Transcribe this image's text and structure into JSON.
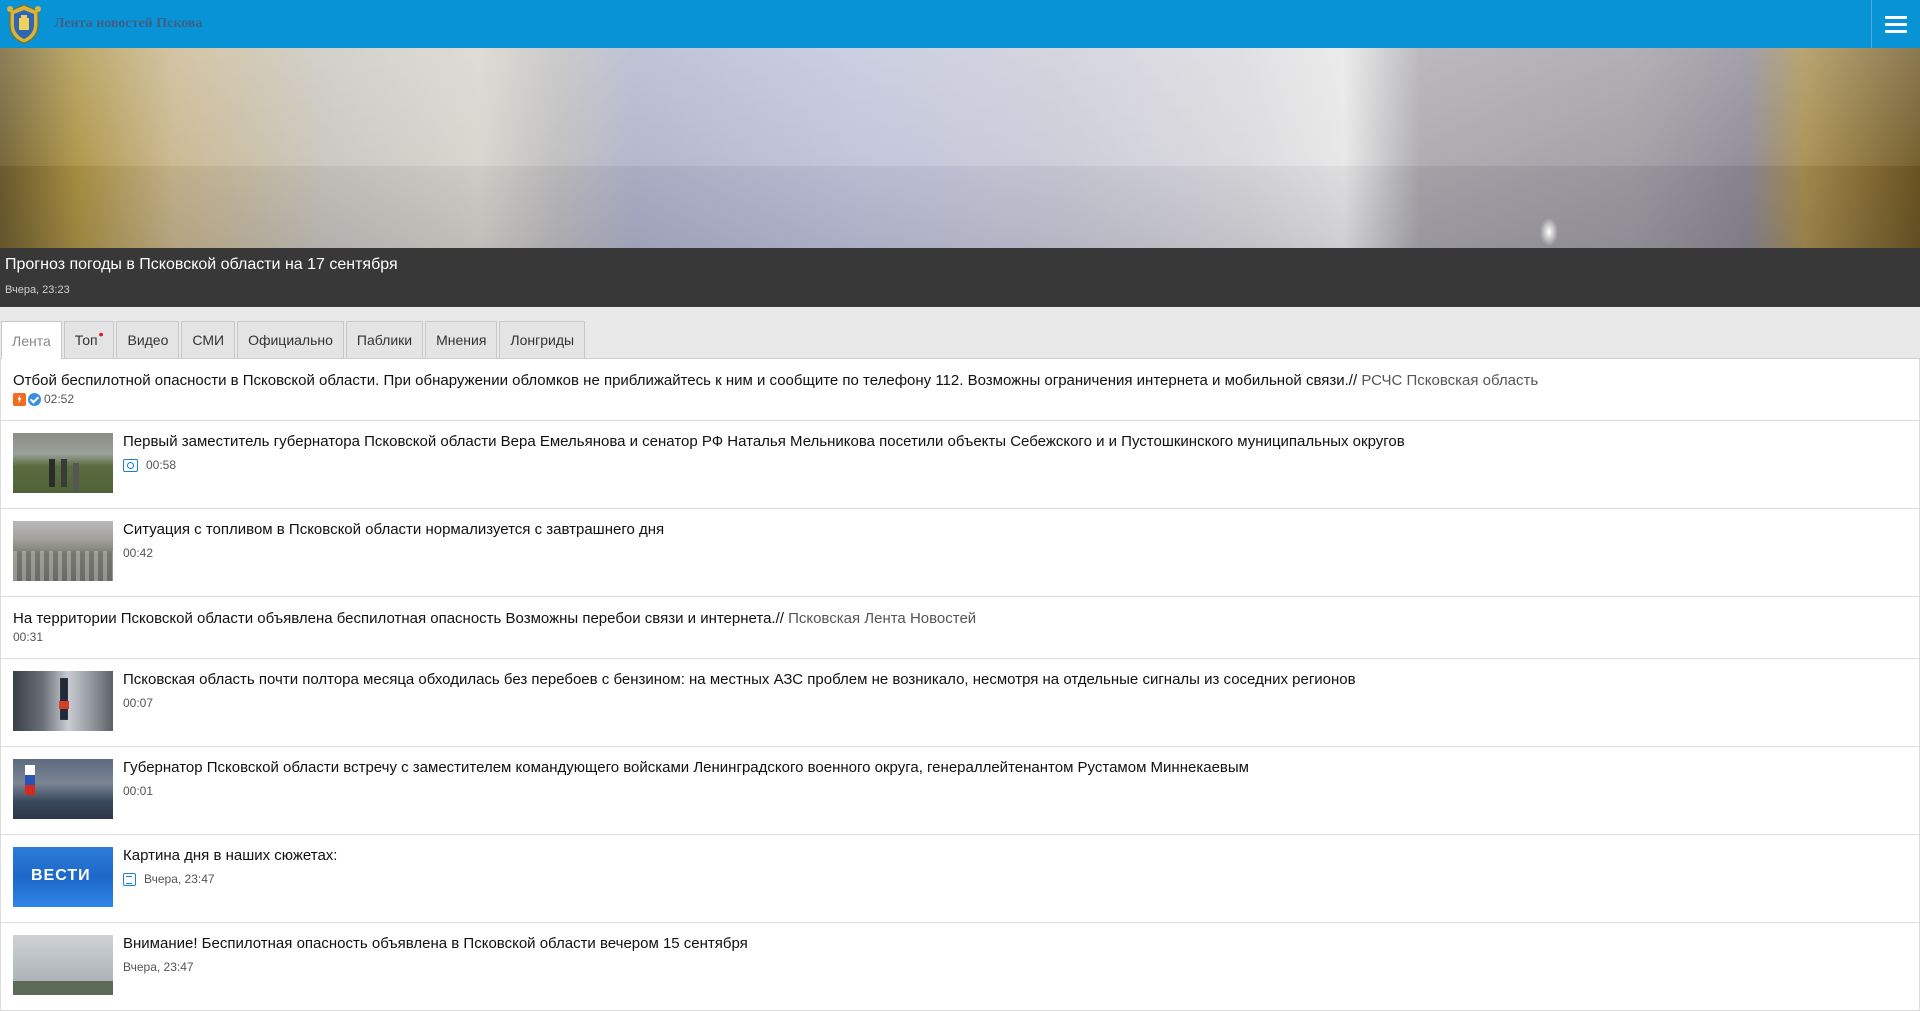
{
  "header": {
    "site_title": "Лента новостей Пскова",
    "logo_icon": "coat-of-arms-icon",
    "menu_icon": "hamburger-menu-icon",
    "brand_color": "#0893d6"
  },
  "hero": {
    "title": "Прогноз погоды в Псковской области на 17 сентября",
    "time": "Вчера, 23:23"
  },
  "tabs": [
    {
      "label": "Лента",
      "active": true
    },
    {
      "label": "Топ",
      "marker": "•"
    },
    {
      "label": "Видео"
    },
    {
      "label": "СМИ"
    },
    {
      "label": "Официально"
    },
    {
      "label": "Паблики"
    },
    {
      "label": "Мнения"
    },
    {
      "label": "Лонгриды"
    }
  ],
  "feed": [
    {
      "title": "Отбой беспилотной опасности в Псковской области. При обнаружении обломков не приближайтесь к ним и сообщите по телефону 112. Возможны ограничения интернета и мобильной связи.// ",
      "source": "РСЧС Псковская область",
      "time": "02:52",
      "icons": [
        "flash-icon",
        "verified-check-icon"
      ]
    },
    {
      "title": "Первый заместитель губернатора Псковской области Вера Емельянова и сенатор РФ Наталья Мельникова посетили объекты Себежского и и Пустошкинского муниципальных округов",
      "time": "00:58",
      "icon": "photo-icon"
    },
    {
      "title": "Ситуация с топливом в Псковской области нормализуется с завтрашнего дня",
      "time": "00:42"
    },
    {
      "title": "На территории Псковской области объявлена беспилотная опасность Возможны перебои связи и интернета.// ",
      "source": "Псковская Лента Новостей",
      "time": "00:31"
    },
    {
      "title": "Псковская область почти полтора месяца обходилась без перебоев с бензином: на местных АЗС проблем не возникало, несмотря на отдельные сигналы из соседних регионов",
      "time": "00:07"
    },
    {
      "title": "Губернатор Псковской области встречу с заместителем командующего войсками Ленинградского военного округа, генераллейтенантом Рустамом Миннекаевым",
      "time": "00:01"
    },
    {
      "title": "Картина дня в наших сюжетах:",
      "time": "Вчера, 23:47",
      "icon": "document-icon",
      "thumb_text": "ВЕСТИ"
    },
    {
      "title": "Внимание! Беспилотная опасность объявлена в Псковской области вечером 15 сентября",
      "time": "Вчера, 23:47"
    }
  ]
}
